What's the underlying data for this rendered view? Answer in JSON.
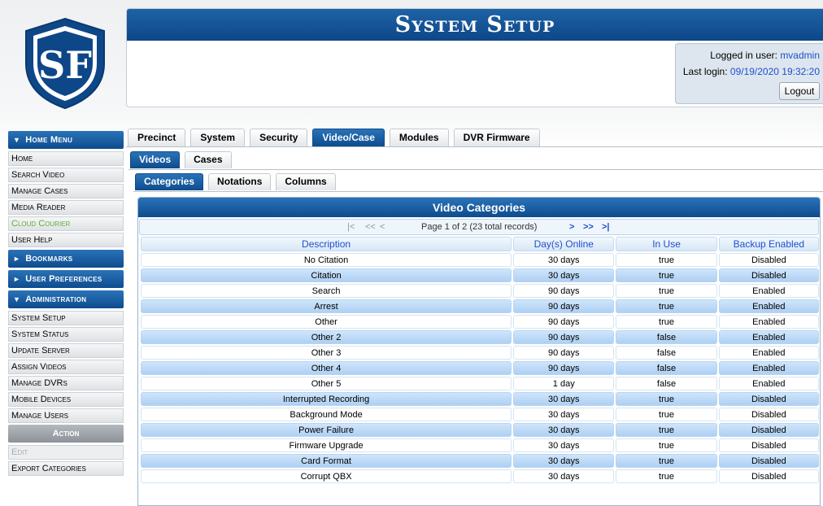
{
  "header": {
    "title": "System Setup",
    "logged_in_label": "Logged in user: ",
    "username": "mvadmin",
    "last_login_label": "Last login: ",
    "last_login_value": "09/19/2020 19:32:20",
    "logout_label": "Logout"
  },
  "logo": {
    "text": "SF",
    "icon": "shield-logo"
  },
  "sidebar": {
    "home_menu_title": "Home Menu",
    "home_items": [
      "Home",
      "Search Video",
      "Manage Cases",
      "Media Reader",
      "Cloud Courier",
      "User Help"
    ],
    "bookmarks_title": "Bookmarks",
    "user_prefs_title": "User Preferences",
    "admin_title": "Administration",
    "admin_items": [
      "System Setup",
      "System Status",
      "Update Server",
      "Assign Videos",
      "Manage DVRs",
      "Mobile Devices",
      "Manage Users"
    ],
    "action_title": "Action",
    "action_items": [
      "Edit",
      "Export Categories"
    ]
  },
  "tabs": {
    "main": [
      "Precinct",
      "System",
      "Security",
      "Video/Case",
      "Modules",
      "DVR Firmware"
    ],
    "main_active": "Video/Case",
    "sub": [
      "Videos",
      "Cases"
    ],
    "sub_active": "Videos",
    "sub2": [
      "Categories",
      "Notations",
      "Columns"
    ],
    "sub2_active": "Categories"
  },
  "panel": {
    "title": "Video Categories",
    "pager": {
      "first": "|<",
      "prev_fast": "<<",
      "prev": "<",
      "text": "Page 1 of 2 (23 total records)",
      "next": ">",
      "next_fast": ">>",
      "last": ">|"
    },
    "columns": [
      "Description",
      "Day(s) Online",
      "In Use",
      "Backup Enabled"
    ],
    "rows": [
      [
        "No Citation",
        "30 days",
        "true",
        "Disabled"
      ],
      [
        "Citation",
        "30 days",
        "true",
        "Disabled"
      ],
      [
        "Search",
        "90 days",
        "true",
        "Enabled"
      ],
      [
        "Arrest",
        "90 days",
        "true",
        "Enabled"
      ],
      [
        "Other",
        "90 days",
        "true",
        "Enabled"
      ],
      [
        "Other 2",
        "90 days",
        "false",
        "Enabled"
      ],
      [
        "Other 3",
        "90 days",
        "false",
        "Enabled"
      ],
      [
        "Other 4",
        "90 days",
        "false",
        "Enabled"
      ],
      [
        "Other 5",
        "1 day",
        "false",
        "Enabled"
      ],
      [
        "Interrupted Recording",
        "30 days",
        "true",
        "Disabled"
      ],
      [
        "Background Mode",
        "30 days",
        "true",
        "Disabled"
      ],
      [
        "Power Failure",
        "30 days",
        "true",
        "Disabled"
      ],
      [
        "Firmware Upgrade",
        "30 days",
        "true",
        "Disabled"
      ],
      [
        "Card Format",
        "30 days",
        "true",
        "Disabled"
      ],
      [
        "Corrupt QBX",
        "30 days",
        "true",
        "Disabled"
      ]
    ]
  },
  "colors": {
    "accent": "#0e4c8d",
    "link": "#1f4fd1",
    "green": "#5fae38"
  }
}
